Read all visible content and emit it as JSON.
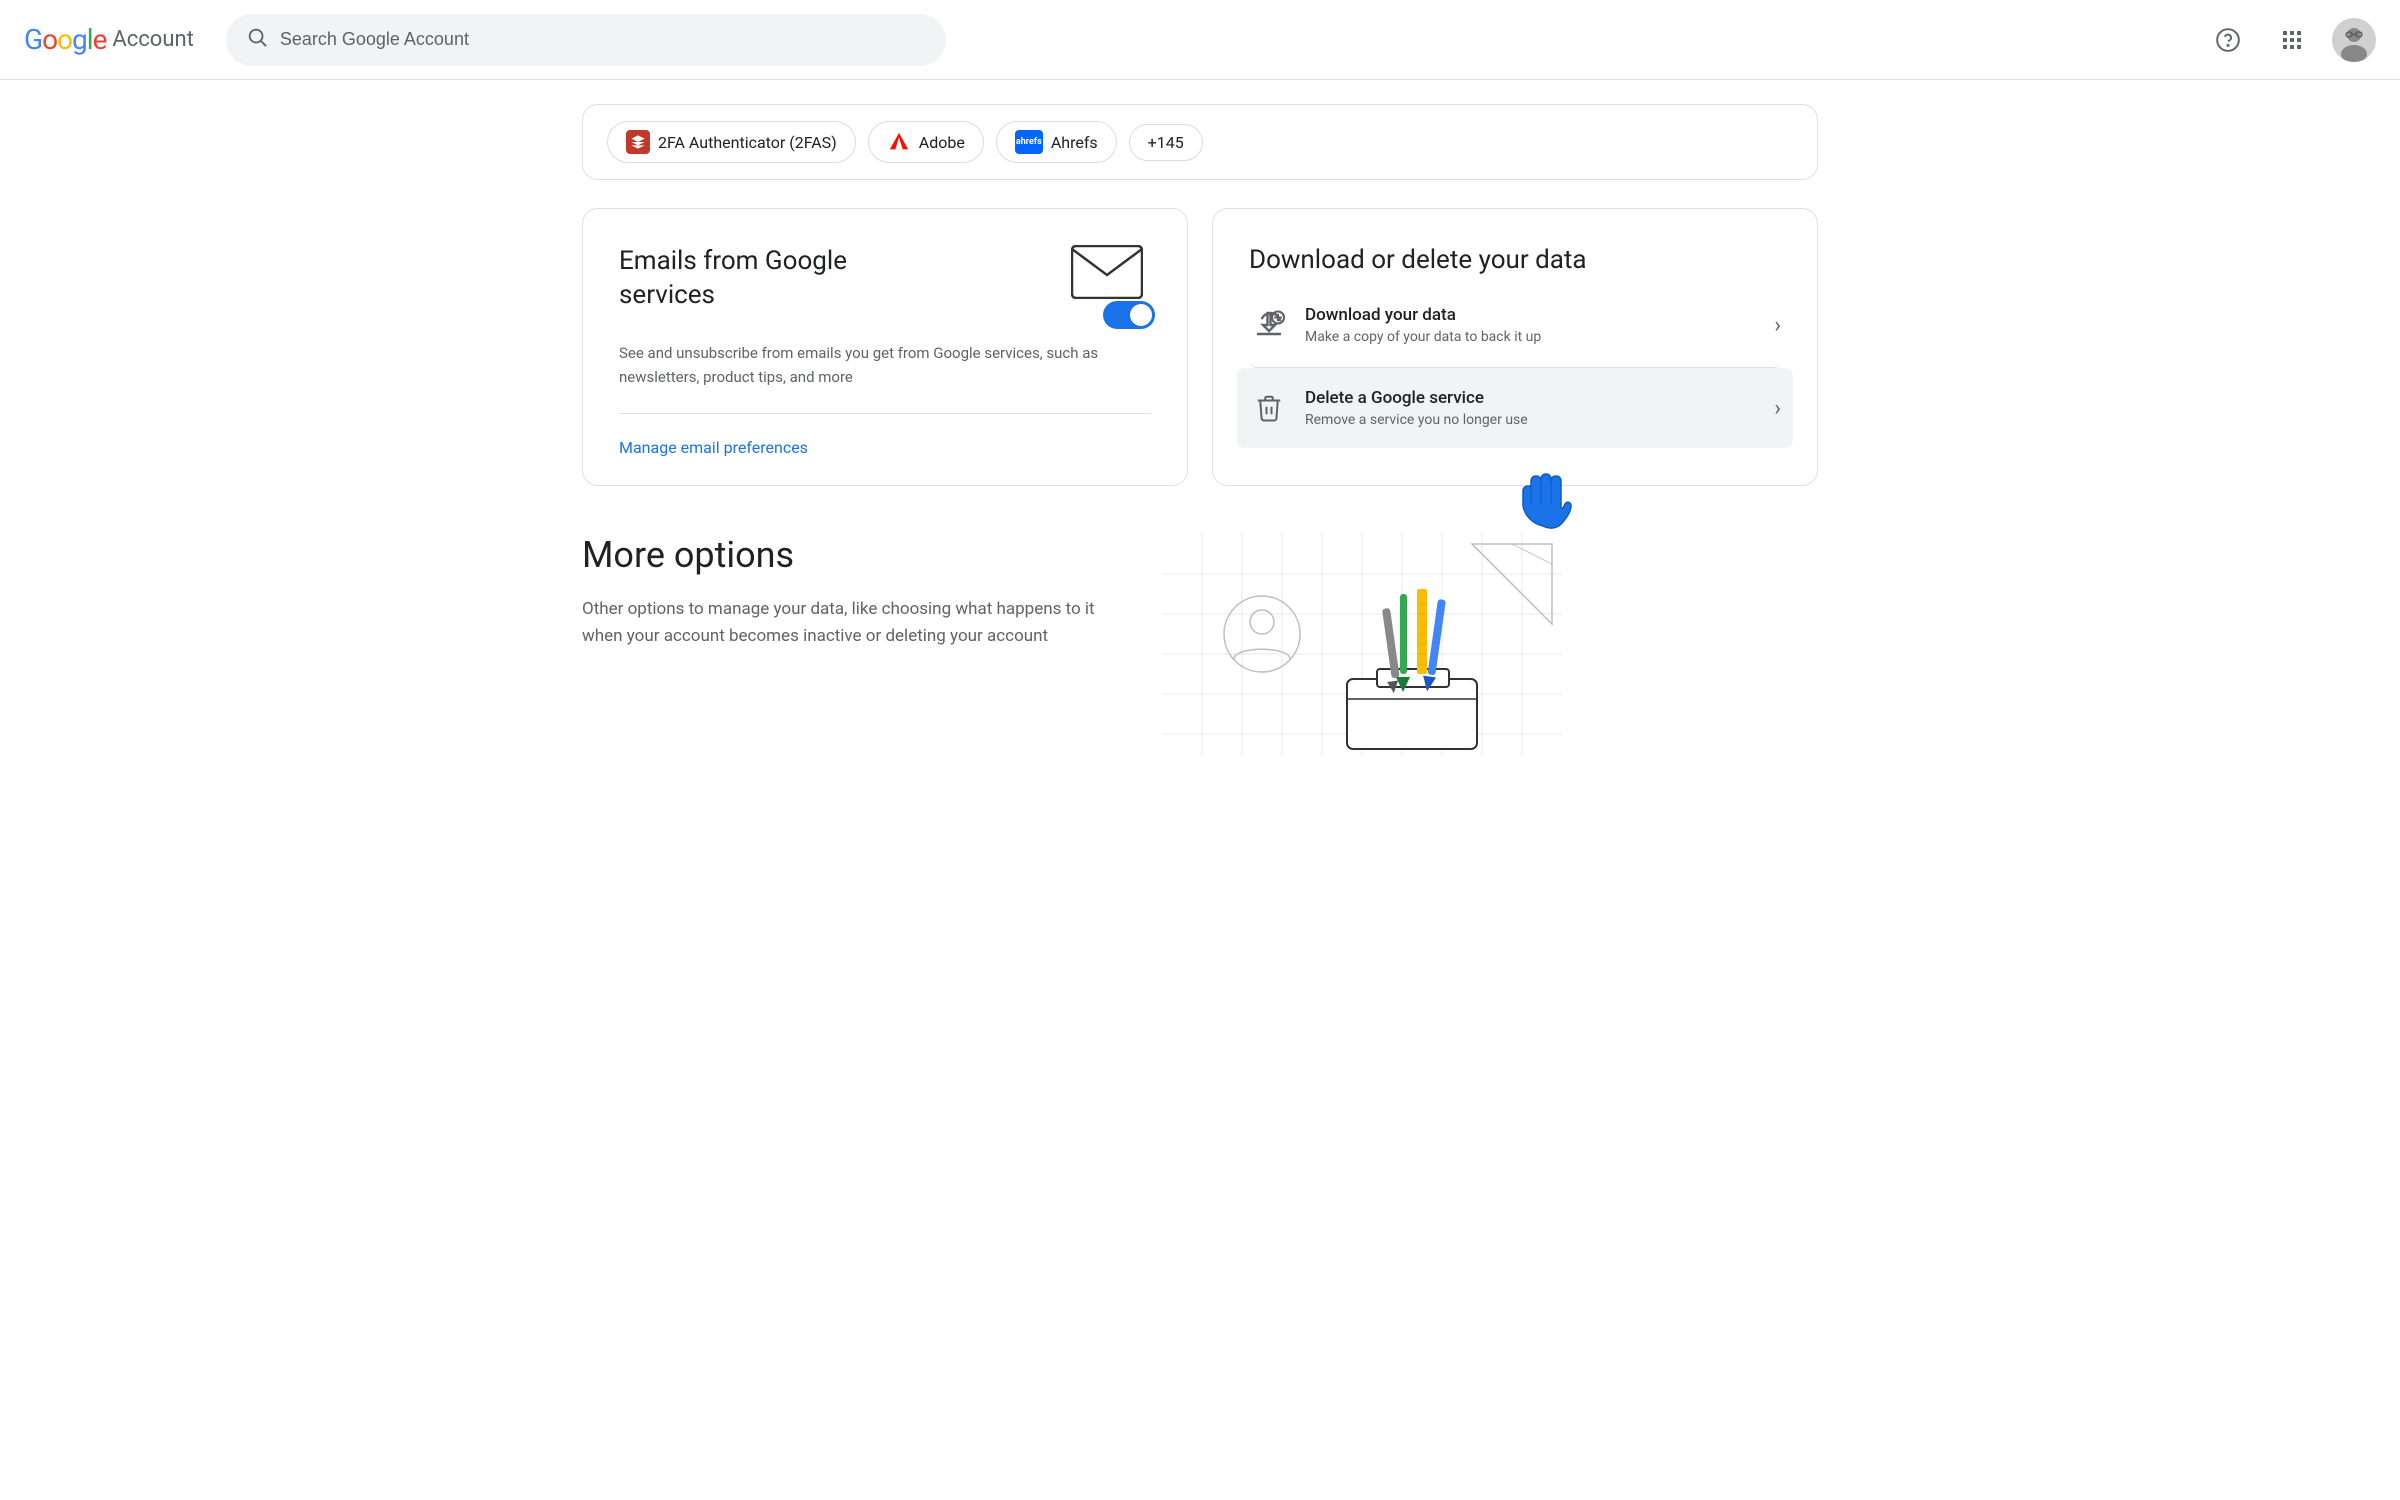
{
  "header": {
    "logo_google": "Google",
    "logo_account": "Account",
    "search_placeholder": "Search Google Account",
    "help_label": "Help",
    "apps_label": "Google apps",
    "avatar_label": "Google Account"
  },
  "chips": [
    {
      "id": "2fas",
      "icon_text": "2FAS",
      "label": "2FA Authenticator (2FAS)",
      "type": "2fas"
    },
    {
      "id": "adobe",
      "icon_text": "A",
      "label": "Adobe",
      "type": "adobe"
    },
    {
      "id": "ahrefs",
      "icon_text": "ahrefs",
      "label": "Ahrefs",
      "type": "ahrefs"
    },
    {
      "id": "more",
      "label": "+145",
      "type": "more"
    }
  ],
  "email_card": {
    "title": "Emails from Google services",
    "description": "See and unsubscribe from emails you get from Google services, such as newsletters, product tips, and more",
    "manage_link_label": "Manage email preferences"
  },
  "download_card": {
    "title": "Download or delete your data",
    "items": [
      {
        "id": "download",
        "icon_type": "cloud-download",
        "title": "Download your data",
        "description": "Make a copy of your data to back it up"
      },
      {
        "id": "delete",
        "icon_type": "trash",
        "title": "Delete a Google service",
        "description": "Remove a service you no longer use"
      }
    ]
  },
  "more_options": {
    "title": "More options",
    "description": "Other options to manage your data, like choosing what happens to it when your account becomes inactive or deleting your account"
  },
  "colors": {
    "blue": "#1a73e8",
    "google_blue": "#4285F4",
    "google_red": "#EA4335",
    "google_yellow": "#FBBC05",
    "google_green": "#34A853",
    "text_primary": "#202124",
    "text_secondary": "#5f6368",
    "border": "#e0e0e0",
    "bg_light": "#f8f9fa"
  }
}
